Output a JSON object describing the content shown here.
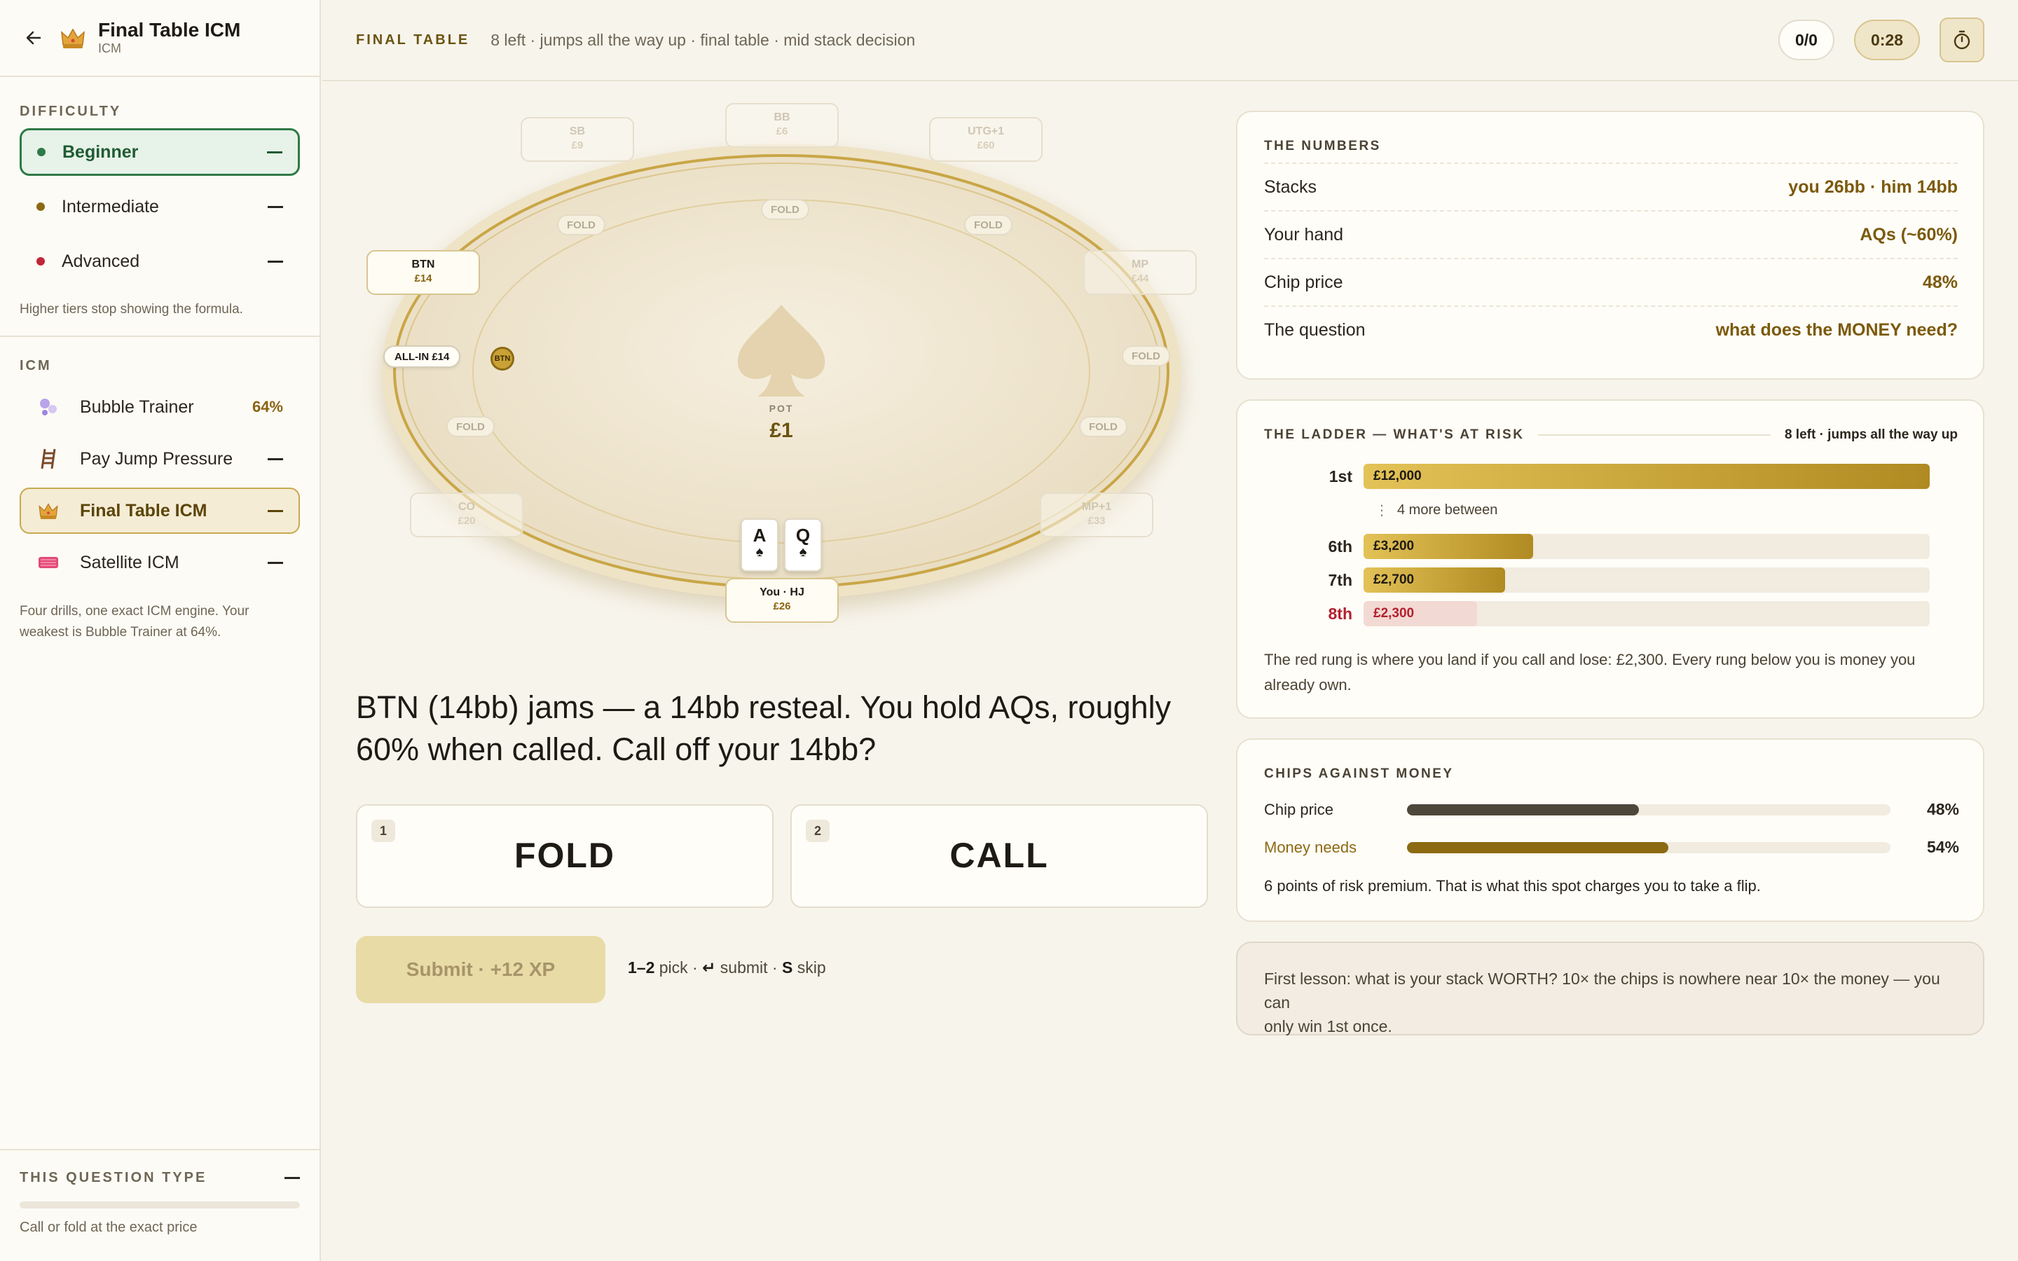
{
  "sidebar": {
    "title": "Final Table ICM",
    "subtitle": "ICM",
    "difficulty_label": "DIFFICULTY",
    "difficulty": [
      {
        "label": "Beginner",
        "color": "#2e7a46"
      },
      {
        "label": "Intermediate",
        "color": "#8a6a12"
      },
      {
        "label": "Advanced",
        "color": "#c0263a"
      }
    ],
    "difficulty_note": "Higher tiers stop showing the formula.",
    "icm_label": "ICM",
    "icm_items": [
      {
        "label": "Bubble Trainer",
        "value": "64%",
        "icon": "bubbles-icon"
      },
      {
        "label": "Pay Jump Pressure",
        "value": "",
        "icon": "ladder-icon"
      },
      {
        "label": "Final Table ICM",
        "value": "",
        "icon": "crown-icon"
      },
      {
        "label": "Satellite ICM",
        "value": "",
        "icon": "ticket-icon"
      }
    ],
    "icm_note_1": "Four drills, one exact ICM engine. Your",
    "icm_note_2": "weakest is Bubble Trainer at 64%.",
    "question_type_label": "THIS QUESTION TYPE",
    "question_type_desc": "Call or fold at the exact price",
    "question_type_progress": 0
  },
  "topbar": {
    "label": "FINAL TABLE",
    "subtitle": "8 left · jumps all the way up · final table · mid stack decision",
    "score": "0/0",
    "timer": "0:28"
  },
  "table": {
    "seats": [
      {
        "name": "SB",
        "stack": "£9"
      },
      {
        "name": "BB",
        "stack": "£6"
      },
      {
        "name": "UTG+1",
        "stack": "£60"
      },
      {
        "name": "MP",
        "stack": "£44"
      },
      {
        "name": "MP+1",
        "stack": "£33"
      },
      {
        "name": "CO",
        "stack": "£20"
      },
      {
        "name": "BTN",
        "stack": "£14"
      },
      {
        "name": "You · HJ",
        "stack": "£26"
      }
    ],
    "fold": "FOLD",
    "allin": "ALL-IN £14",
    "button_chip": "BTN",
    "pot_label": "POT",
    "pot_value": "£1",
    "cards": [
      {
        "rank": "A",
        "suit": "♠"
      },
      {
        "rank": "Q",
        "suit": "♠"
      }
    ]
  },
  "question": {
    "line1": "BTN (14bb) jams — a 14bb resteal. You hold AQs, roughly",
    "line2": "60% when called. Call off your 14bb?",
    "answers": [
      {
        "key": "1",
        "label": "FOLD"
      },
      {
        "key": "2",
        "label": "CALL"
      }
    ],
    "submit": "Submit · +12 XP",
    "hint_keys_1": "1–2",
    "hint_word_1": "pick ·",
    "hint_keys_2": "↵",
    "hint_word_2": "submit ·",
    "hint_keys_3": "S",
    "hint_word_3": "skip"
  },
  "numbers": {
    "title": "THE NUMBERS",
    "rows": [
      {
        "label": "Stacks",
        "value": "you 26bb · him 14bb"
      },
      {
        "label": "Your hand",
        "value": "AQs (~60%)"
      },
      {
        "label": "Chip price",
        "value": "48%"
      },
      {
        "label": "The question",
        "value": "what does the MONEY need?"
      }
    ]
  },
  "ladder": {
    "title": "THE LADDER — WHAT'S AT RISK",
    "subtitle": "8 left · jumps all the way up",
    "rungs": [
      {
        "place": "1st",
        "amount": "£12,000",
        "fraction": 1.0
      },
      {
        "place": "6th",
        "amount": "£3,200",
        "fraction": 0.3
      },
      {
        "place": "7th",
        "amount": "£2,700",
        "fraction": 0.25
      },
      {
        "place": "8th",
        "amount": "£2,300",
        "fraction": 0.2
      }
    ],
    "between": "4 more between",
    "note_1": "The red rung is where you land if you call and lose: £2,300. Every rung below you is money you",
    "note_2": "already own."
  },
  "chips_vs_money": {
    "title": "CHIPS AGAINST MONEY",
    "rows": [
      {
        "label": "Chip price",
        "value": "48%",
        "fraction": 0.48,
        "color": "#4d463a"
      },
      {
        "label": "Money needs",
        "value": "54%",
        "fraction": 0.54,
        "color": "#8c6a12"
      }
    ],
    "note": "6 points of risk premium. That is what this spot charges you to take a flip."
  },
  "lesson": {
    "line1": "First lesson: what is your stack WORTH? 10× the chips is nowhere near 10× the money — you can",
    "line2": "only win 1st once."
  }
}
